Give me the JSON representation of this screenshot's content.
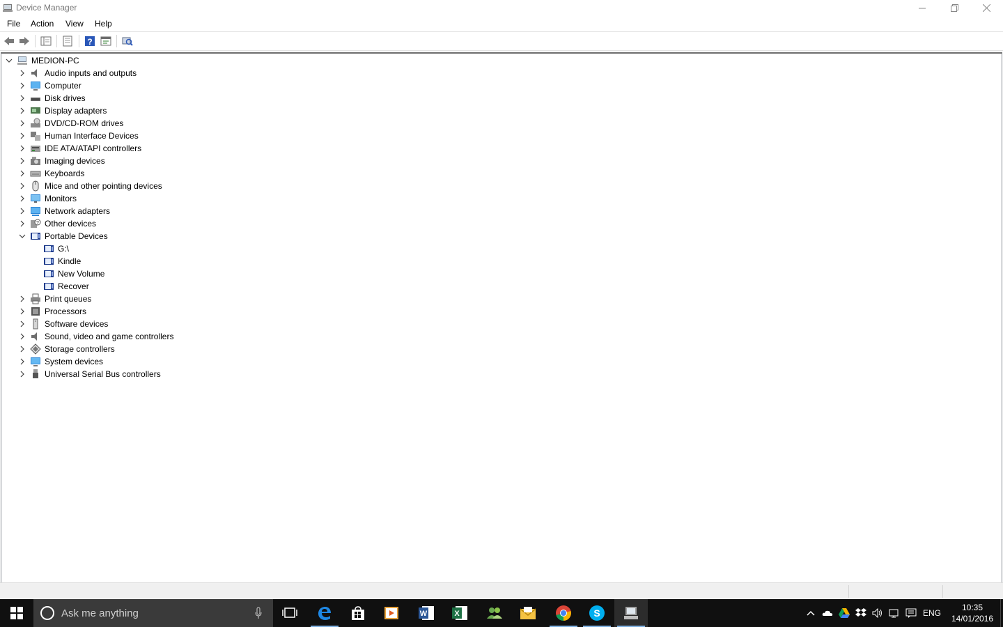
{
  "window": {
    "title": "Device Manager"
  },
  "menu": {
    "items": [
      "File",
      "Action",
      "View",
      "Help"
    ]
  },
  "toolbar": {
    "buttons": [
      "back-icon",
      "forward-icon",
      "show-hide-console-tree-icon",
      "properties-icon",
      "help-icon",
      "update-driver-icon",
      "scan-hardware-icon"
    ]
  },
  "tree": {
    "root": "MEDION-PC",
    "categories": [
      {
        "label": "Audio inputs and outputs",
        "icon": "speaker-icon",
        "expanded": false
      },
      {
        "label": "Computer",
        "icon": "computer-icon",
        "expanded": false
      },
      {
        "label": "Disk drives",
        "icon": "disk-drive-icon",
        "expanded": false
      },
      {
        "label": "Display adapters",
        "icon": "display-adapter-icon",
        "expanded": false
      },
      {
        "label": "DVD/CD-ROM drives",
        "icon": "dvd-drive-icon",
        "expanded": false
      },
      {
        "label": "Human Interface Devices",
        "icon": "hid-icon",
        "expanded": false
      },
      {
        "label": "IDE ATA/ATAPI controllers",
        "icon": "ide-controller-icon",
        "expanded": false
      },
      {
        "label": "Imaging devices",
        "icon": "camera-icon",
        "expanded": false
      },
      {
        "label": "Keyboards",
        "icon": "keyboard-icon",
        "expanded": false
      },
      {
        "label": "Mice and other pointing devices",
        "icon": "mouse-icon",
        "expanded": false
      },
      {
        "label": "Monitors",
        "icon": "monitor-icon",
        "expanded": false
      },
      {
        "label": "Network adapters",
        "icon": "network-adapter-icon",
        "expanded": false
      },
      {
        "label": "Other devices",
        "icon": "unknown-device-icon",
        "expanded": false
      },
      {
        "label": "Portable Devices",
        "icon": "portable-device-icon",
        "expanded": true,
        "children": [
          "G:\\",
          "Kindle",
          "New Volume",
          "Recover"
        ]
      },
      {
        "label": "Print queues",
        "icon": "printer-icon",
        "expanded": false
      },
      {
        "label": "Processors",
        "icon": "processor-icon",
        "expanded": false
      },
      {
        "label": "Software devices",
        "icon": "software-device-icon",
        "expanded": false
      },
      {
        "label": "Sound, video and game controllers",
        "icon": "speaker-icon",
        "expanded": false
      },
      {
        "label": "Storage controllers",
        "icon": "storage-controller-icon",
        "expanded": false
      },
      {
        "label": "System devices",
        "icon": "system-device-icon",
        "expanded": false
      },
      {
        "label": "Universal Serial Bus controllers",
        "icon": "usb-icon",
        "expanded": false
      }
    ]
  },
  "taskbar": {
    "search_placeholder": "Ask me anything",
    "apps": [
      "task-view-icon",
      "edge-icon",
      "store-icon",
      "media-icon",
      "word-icon",
      "excel-icon",
      "people-icon",
      "mail-icon",
      "chrome-icon",
      "skype-icon",
      "device-manager-icon"
    ],
    "language": "ENG",
    "time": "10:35",
    "date": "14/01/2016"
  }
}
